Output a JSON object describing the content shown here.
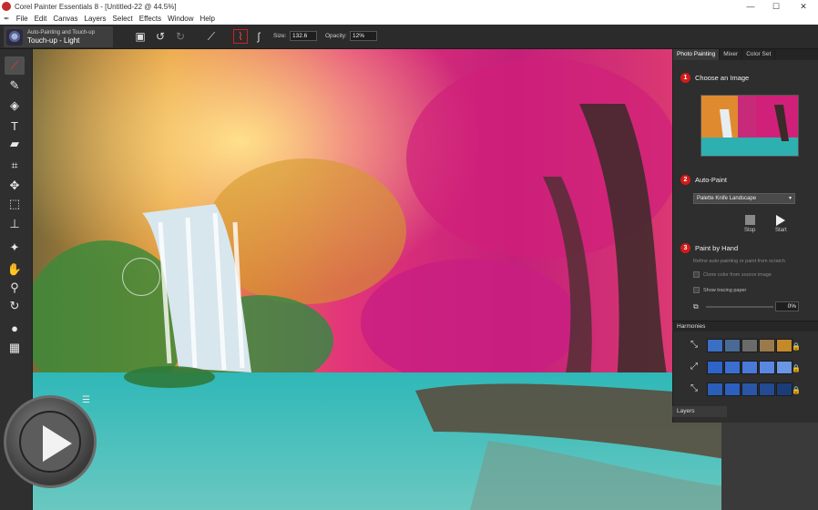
{
  "window": {
    "title": "Corel Painter Essentials 8 - [Untitled-22 @ 44.5%]",
    "min": "—",
    "max": "☐",
    "close": "✕"
  },
  "menu": [
    "File",
    "Edit",
    "Canvas",
    "Layers",
    "Select",
    "Effects",
    "Window",
    "Help"
  ],
  "property_bar": {
    "brush_category": "Auto-Painting and Touch-up",
    "brush_variant": "Touch-up - Light",
    "size_label": "Size:",
    "size_value": "132.6",
    "opacity_label": "Opacity:",
    "opacity_value": "12%"
  },
  "tools": [
    {
      "name": "brush-tool-icon",
      "glyph": "⟋"
    },
    {
      "name": "dropper-tool-icon",
      "glyph": "✎"
    },
    {
      "name": "paint-bucket-tool-icon",
      "glyph": "◈"
    },
    {
      "name": "text-tool-icon",
      "glyph": "T"
    },
    {
      "name": "eraser-tool-icon",
      "glyph": "▰"
    },
    {
      "name": "crop-tool-icon",
      "glyph": "⌗"
    },
    {
      "name": "transform-tool-icon",
      "glyph": "✥"
    },
    {
      "name": "rect-select-tool-icon",
      "glyph": "⬚"
    },
    {
      "name": "clone-stamp-tool-icon",
      "glyph": "⊥"
    },
    {
      "name": "magic-wand-tool-icon",
      "glyph": "✦"
    },
    {
      "name": "hand-tool-icon",
      "glyph": "✋"
    },
    {
      "name": "magnifier-tool-icon",
      "glyph": "⚲"
    },
    {
      "name": "rotate-tool-icon",
      "glyph": "↻"
    },
    {
      "name": "color-swatch-icon",
      "glyph": "●"
    },
    {
      "name": "paper-texture-icon",
      "glyph": "▦"
    }
  ],
  "panel": {
    "tabs": [
      "Photo Painting",
      "Mixer",
      "Color Set"
    ],
    "step1": {
      "num": "1",
      "label": "Choose an Image"
    },
    "step2": {
      "num": "2",
      "label": "Auto-Paint",
      "style": "Palette Knife Landscape",
      "stop": "Stop",
      "start": "Start"
    },
    "step3": {
      "num": "3",
      "label": "Paint by Hand",
      "hint": "Refine auto-painting or paint from scratch",
      "clone_color": "Clone color from source image",
      "tracing_paper": "Show tracing paper",
      "percent": "0%"
    }
  },
  "harmonies": {
    "title": "Harmonies",
    "rows": [
      {
        "icon": "harmony-complementary-icon",
        "colors": [
          "#3a6fc4",
          "#4a6a96",
          "#6b6b6b",
          "#9a7a4a",
          "#c48a2a"
        ]
      },
      {
        "icon": "harmony-analogous-icon",
        "colors": [
          "#2f64c8",
          "#3a6fd0",
          "#4a7ad8",
          "#5a88e0",
          "#6a96e6"
        ]
      },
      {
        "icon": "harmony-monochrome-icon",
        "colors": [
          "#2a5eb8",
          "#2c5fbe",
          "#2a56a8",
          "#234a92",
          "#1c3c78"
        ]
      }
    ]
  },
  "layers": {
    "title": "Layers"
  }
}
